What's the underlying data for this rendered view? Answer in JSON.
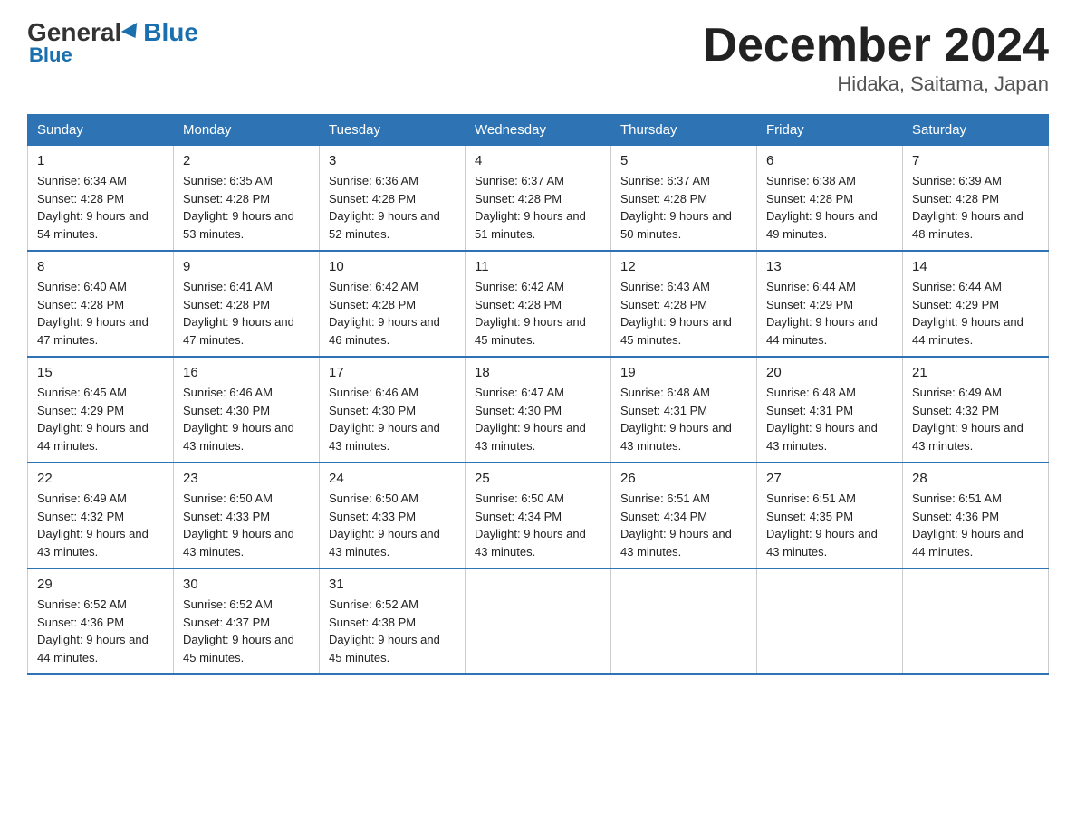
{
  "logo": {
    "general": "General",
    "blue": "Blue"
  },
  "title": "December 2024",
  "location": "Hidaka, Saitama, Japan",
  "days_of_week": [
    "Sunday",
    "Monday",
    "Tuesday",
    "Wednesday",
    "Thursday",
    "Friday",
    "Saturday"
  ],
  "weeks": [
    [
      {
        "num": "1",
        "sunrise": "6:34 AM",
        "sunset": "4:28 PM",
        "daylight": "9 hours and 54 minutes."
      },
      {
        "num": "2",
        "sunrise": "6:35 AM",
        "sunset": "4:28 PM",
        "daylight": "9 hours and 53 minutes."
      },
      {
        "num": "3",
        "sunrise": "6:36 AM",
        "sunset": "4:28 PM",
        "daylight": "9 hours and 52 minutes."
      },
      {
        "num": "4",
        "sunrise": "6:37 AM",
        "sunset": "4:28 PM",
        "daylight": "9 hours and 51 minutes."
      },
      {
        "num": "5",
        "sunrise": "6:37 AM",
        "sunset": "4:28 PM",
        "daylight": "9 hours and 50 minutes."
      },
      {
        "num": "6",
        "sunrise": "6:38 AM",
        "sunset": "4:28 PM",
        "daylight": "9 hours and 49 minutes."
      },
      {
        "num": "7",
        "sunrise": "6:39 AM",
        "sunset": "4:28 PM",
        "daylight": "9 hours and 48 minutes."
      }
    ],
    [
      {
        "num": "8",
        "sunrise": "6:40 AM",
        "sunset": "4:28 PM",
        "daylight": "9 hours and 47 minutes."
      },
      {
        "num": "9",
        "sunrise": "6:41 AM",
        "sunset": "4:28 PM",
        "daylight": "9 hours and 47 minutes."
      },
      {
        "num": "10",
        "sunrise": "6:42 AM",
        "sunset": "4:28 PM",
        "daylight": "9 hours and 46 minutes."
      },
      {
        "num": "11",
        "sunrise": "6:42 AM",
        "sunset": "4:28 PM",
        "daylight": "9 hours and 45 minutes."
      },
      {
        "num": "12",
        "sunrise": "6:43 AM",
        "sunset": "4:28 PM",
        "daylight": "9 hours and 45 minutes."
      },
      {
        "num": "13",
        "sunrise": "6:44 AM",
        "sunset": "4:29 PM",
        "daylight": "9 hours and 44 minutes."
      },
      {
        "num": "14",
        "sunrise": "6:44 AM",
        "sunset": "4:29 PM",
        "daylight": "9 hours and 44 minutes."
      }
    ],
    [
      {
        "num": "15",
        "sunrise": "6:45 AM",
        "sunset": "4:29 PM",
        "daylight": "9 hours and 44 minutes."
      },
      {
        "num": "16",
        "sunrise": "6:46 AM",
        "sunset": "4:30 PM",
        "daylight": "9 hours and 43 minutes."
      },
      {
        "num": "17",
        "sunrise": "6:46 AM",
        "sunset": "4:30 PM",
        "daylight": "9 hours and 43 minutes."
      },
      {
        "num": "18",
        "sunrise": "6:47 AM",
        "sunset": "4:30 PM",
        "daylight": "9 hours and 43 minutes."
      },
      {
        "num": "19",
        "sunrise": "6:48 AM",
        "sunset": "4:31 PM",
        "daylight": "9 hours and 43 minutes."
      },
      {
        "num": "20",
        "sunrise": "6:48 AM",
        "sunset": "4:31 PM",
        "daylight": "9 hours and 43 minutes."
      },
      {
        "num": "21",
        "sunrise": "6:49 AM",
        "sunset": "4:32 PM",
        "daylight": "9 hours and 43 minutes."
      }
    ],
    [
      {
        "num": "22",
        "sunrise": "6:49 AM",
        "sunset": "4:32 PM",
        "daylight": "9 hours and 43 minutes."
      },
      {
        "num": "23",
        "sunrise": "6:50 AM",
        "sunset": "4:33 PM",
        "daylight": "9 hours and 43 minutes."
      },
      {
        "num": "24",
        "sunrise": "6:50 AM",
        "sunset": "4:33 PM",
        "daylight": "9 hours and 43 minutes."
      },
      {
        "num": "25",
        "sunrise": "6:50 AM",
        "sunset": "4:34 PM",
        "daylight": "9 hours and 43 minutes."
      },
      {
        "num": "26",
        "sunrise": "6:51 AM",
        "sunset": "4:34 PM",
        "daylight": "9 hours and 43 minutes."
      },
      {
        "num": "27",
        "sunrise": "6:51 AM",
        "sunset": "4:35 PM",
        "daylight": "9 hours and 43 minutes."
      },
      {
        "num": "28",
        "sunrise": "6:51 AM",
        "sunset": "4:36 PM",
        "daylight": "9 hours and 44 minutes."
      }
    ],
    [
      {
        "num": "29",
        "sunrise": "6:52 AM",
        "sunset": "4:36 PM",
        "daylight": "9 hours and 44 minutes."
      },
      {
        "num": "30",
        "sunrise": "6:52 AM",
        "sunset": "4:37 PM",
        "daylight": "9 hours and 45 minutes."
      },
      {
        "num": "31",
        "sunrise": "6:52 AM",
        "sunset": "4:38 PM",
        "daylight": "9 hours and 45 minutes."
      },
      null,
      null,
      null,
      null
    ]
  ]
}
